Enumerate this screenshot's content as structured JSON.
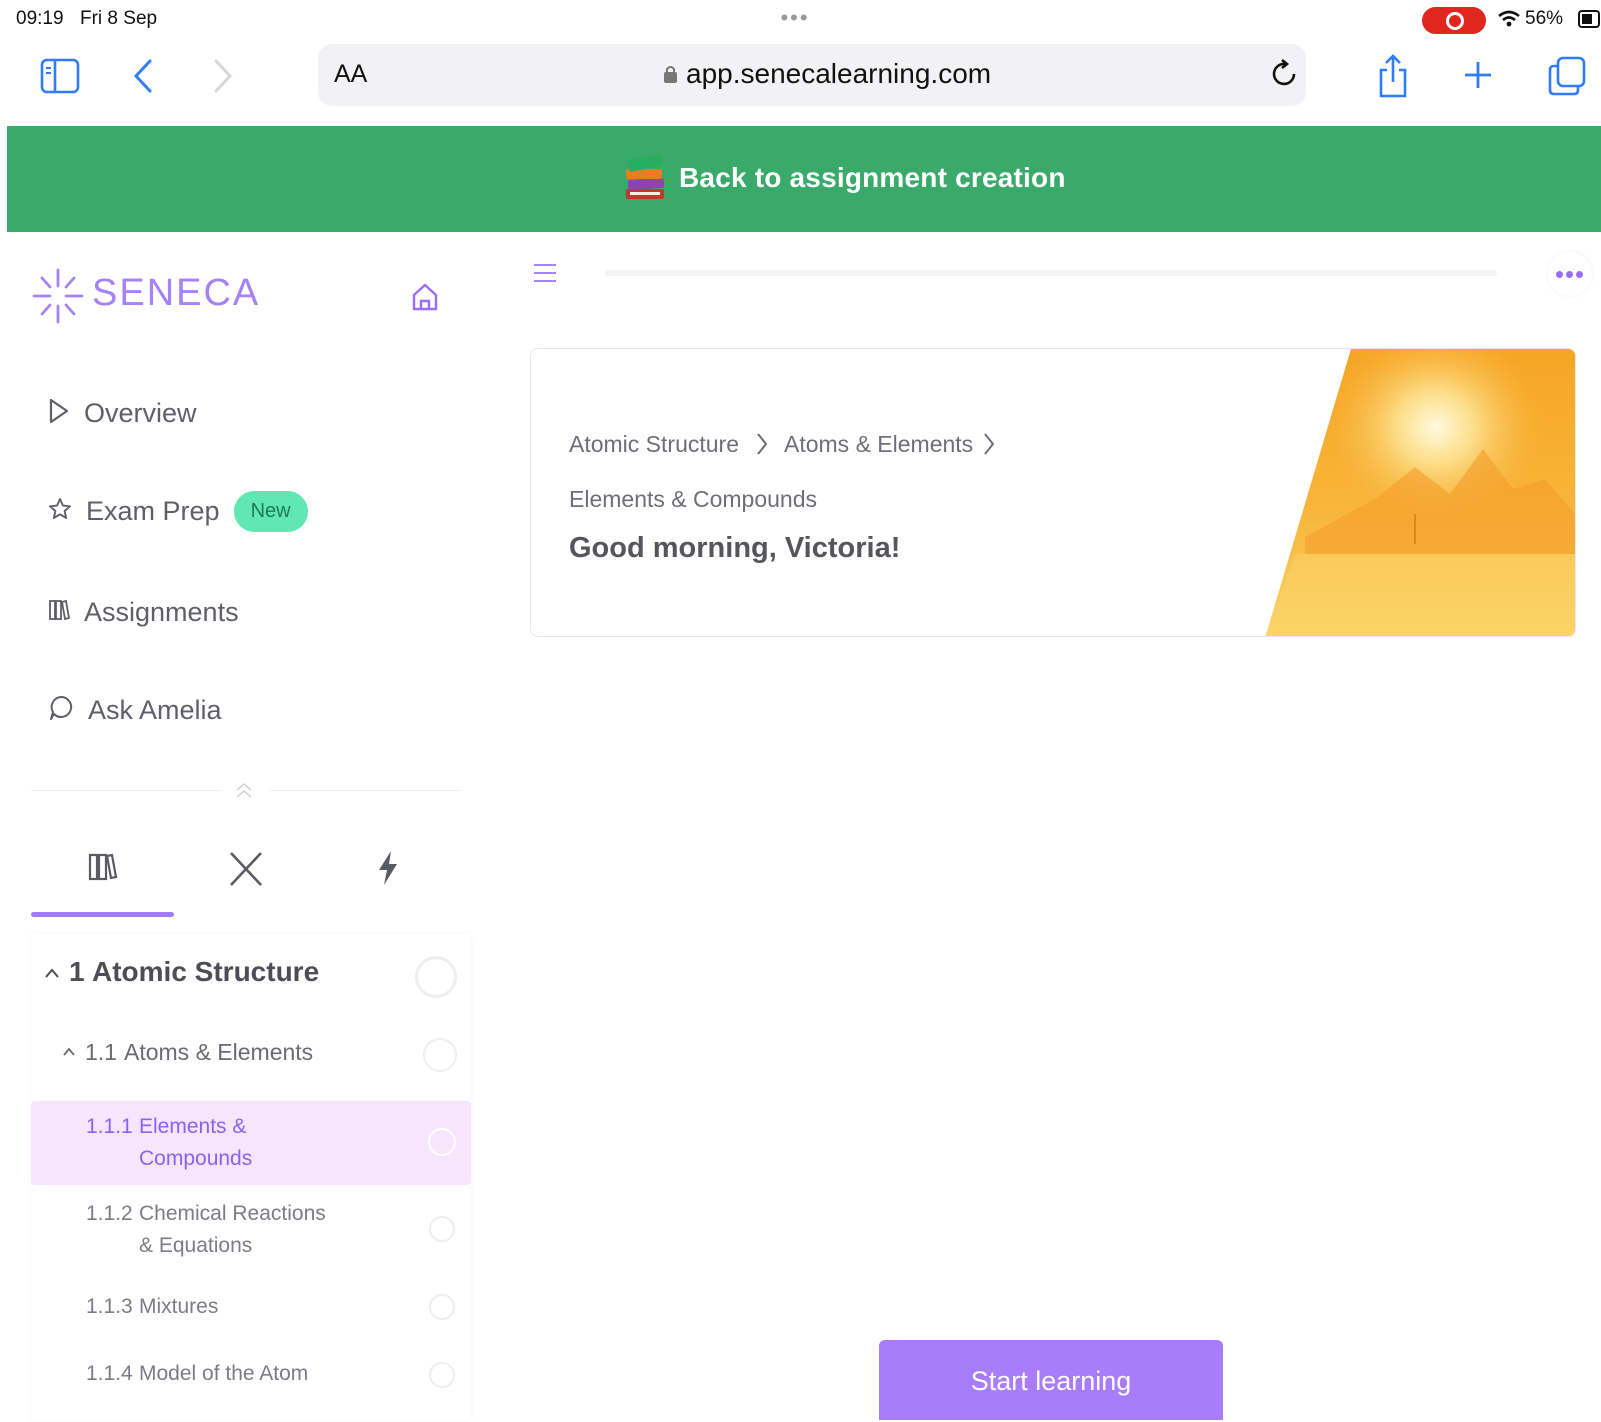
{
  "status_bar": {
    "time": "09:19",
    "date": "Fri 8 Sep",
    "battery": "56%"
  },
  "browser": {
    "text_size": "AA",
    "url": "app.senecalearning.com"
  },
  "banner": {
    "text": "Back to assignment creation"
  },
  "sidebar": {
    "logo": "SENECA",
    "nav": [
      {
        "label": "Overview",
        "icon": "play-outline-icon"
      },
      {
        "label": "Exam Prep",
        "icon": "star-outline-icon",
        "badge": "New"
      },
      {
        "label": "Assignments",
        "icon": "books-icon"
      },
      {
        "label": "Ask Amelia",
        "icon": "chat-bubble-icon"
      }
    ],
    "tabs": [
      "books-icon",
      "close-icon",
      "lightning-icon"
    ],
    "toc": [
      {
        "num": "1",
        "title": "Atomic Structure",
        "level": 1
      },
      {
        "num": "1.1",
        "title": "Atoms & Elements",
        "level": 2
      },
      {
        "num": "1.1.1",
        "title_line1": "Elements &",
        "title_line2": "Compounds",
        "level": 3,
        "selected": true
      },
      {
        "num": "1.1.2",
        "title_line1": "Chemical Reactions",
        "title_line2": "& Equations",
        "level": 3
      },
      {
        "num": "1.1.3",
        "title_line1": "Mixtures",
        "level": 3
      },
      {
        "num": "1.1.4",
        "title_line1": "Model of the Atom",
        "level": 3
      }
    ]
  },
  "main": {
    "breadcrumb": [
      "Atomic Structure",
      "Atoms & Elements",
      "Elements & Compounds"
    ],
    "greeting": "Good morning, Victoria!",
    "start_button": "Start learning"
  },
  "colors": {
    "brand": "#a582f7",
    "banner": "#3aaa6b",
    "badge": "#5fe8b2",
    "button": "#a87cfb"
  }
}
